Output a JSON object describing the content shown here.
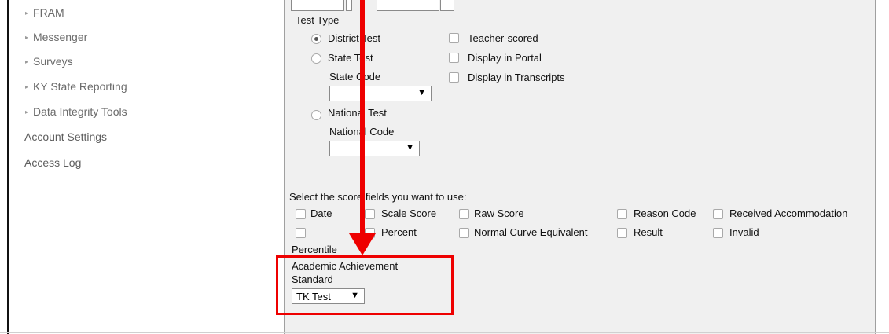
{
  "sidebar": {
    "sub_items": [
      {
        "label": "FRAM"
      },
      {
        "label": "Messenger"
      },
      {
        "label": "Surveys"
      },
      {
        "label": "KY State Reporting"
      },
      {
        "label": "Data Integrity Tools"
      }
    ],
    "top_items": [
      {
        "label": "Account Settings"
      },
      {
        "label": "Access Log"
      }
    ]
  },
  "form": {
    "test_type_label": "Test Type",
    "district_test": "District Test",
    "state_test": "State Test",
    "state_code_label": "State Code",
    "national_test": "National Test",
    "national_code_label": "National Code",
    "teacher_scored": "Teacher-scored",
    "display_in_portal": "Display in Portal",
    "display_in_transcripts": "Display in Transcripts",
    "score_fields_label": "Select the score fields you want to use:",
    "score_fields": {
      "date": "Date",
      "scale_score": "Scale Score",
      "raw_score": "Raw Score",
      "reason_code": "Reason Code",
      "received_accommodation": "Received Accommodation",
      "percent": "Percent",
      "normal_curve_equivalent": "Normal Curve Equivalent",
      "result": "Result",
      "invalid": "Invalid",
      "percentile": "Percentile"
    },
    "academic_achievement_label_line1": "Academic Achievement",
    "academic_achievement_label_line2": "Standard",
    "academic_achievement_value": "TK Test"
  },
  "icons": {
    "dropdown_arrow": "▼",
    "expand_triangle": "▸"
  },
  "colors": {
    "annotation_red": "#ee0000",
    "panel_bg": "#f0f0f0"
  }
}
